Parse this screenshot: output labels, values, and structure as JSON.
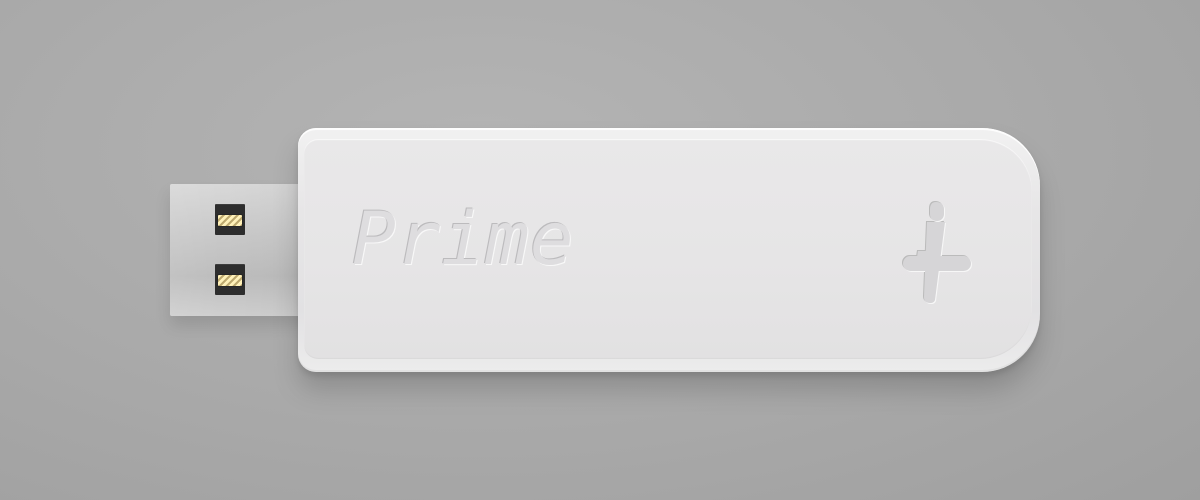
{
  "device": {
    "brand": "Prime",
    "logo_icon": "plus-icon"
  },
  "colors": {
    "background": "#a9a9a9",
    "body": "#e7e6e7",
    "connector": "#c8c8c8",
    "slot": "#2d2d2d",
    "contacts": "#f3e6b0"
  }
}
